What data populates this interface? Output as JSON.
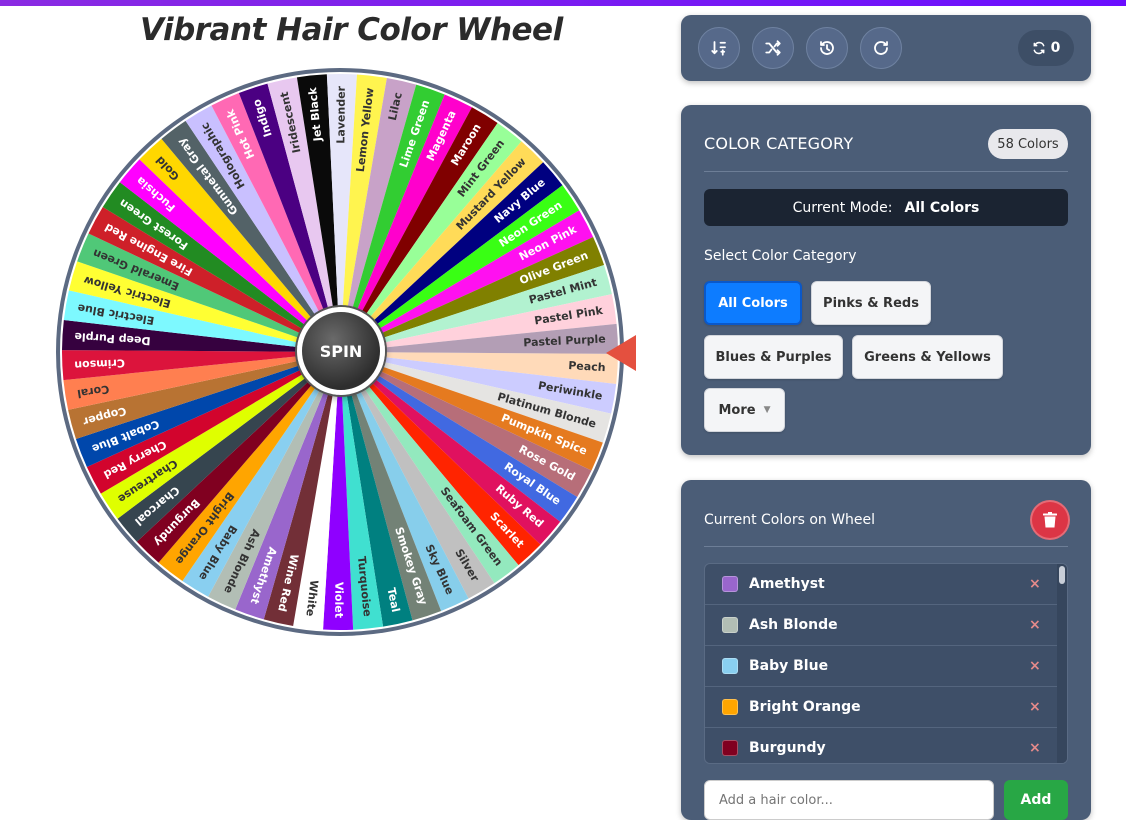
{
  "app": {
    "title": "Vibrant Hair Color Wheel"
  },
  "wheel": {
    "spin_label": "SPIN",
    "segments": [
      {
        "label": "Peach",
        "color": "#FFDAB9",
        "text": "#333333"
      },
      {
        "label": "Periwinkle",
        "color": "#CCCCFF",
        "text": "#333333"
      },
      {
        "label": "Platinum Blonde",
        "color": "#E5E4E2",
        "text": "#333333"
      },
      {
        "label": "Pumpkin Spice",
        "color": "#E57A1F",
        "text": "#ffffff"
      },
      {
        "label": "Rose Gold",
        "color": "#B76E79",
        "text": "#ffffff"
      },
      {
        "label": "Royal Blue",
        "color": "#4169E1",
        "text": "#ffffff"
      },
      {
        "label": "Ruby Red",
        "color": "#E0115F",
        "text": "#ffffff"
      },
      {
        "label": "Scarlet",
        "color": "#FF2400",
        "text": "#ffffff"
      },
      {
        "label": "Seafoam Green",
        "color": "#93E9BE",
        "text": "#333333"
      },
      {
        "label": "Silver",
        "color": "#C0C0C0",
        "text": "#333333"
      },
      {
        "label": "Sky Blue",
        "color": "#87CEEB",
        "text": "#333333"
      },
      {
        "label": "Smokey Gray",
        "color": "#738276",
        "text": "#ffffff"
      },
      {
        "label": "Teal",
        "color": "#008080",
        "text": "#ffffff"
      },
      {
        "label": "Turquoise",
        "color": "#40E0D0",
        "text": "#333333"
      },
      {
        "label": "Violet",
        "color": "#8F00FF",
        "text": "#ffffff"
      },
      {
        "label": "White",
        "color": "#FFFFFF",
        "text": "#333333"
      },
      {
        "label": "Wine Red",
        "color": "#722F37",
        "text": "#ffffff"
      },
      {
        "label": "Amethyst",
        "color": "#9966CC",
        "text": "#ffffff"
      },
      {
        "label": "Ash Blonde",
        "color": "#B2BEB5",
        "text": "#333333"
      },
      {
        "label": "Baby Blue",
        "color": "#89CFF0",
        "text": "#333333"
      },
      {
        "label": "Bright Orange",
        "color": "#FFA500",
        "text": "#333333"
      },
      {
        "label": "Burgundy",
        "color": "#800020",
        "text": "#ffffff"
      },
      {
        "label": "Charcoal",
        "color": "#36454F",
        "text": "#ffffff"
      },
      {
        "label": "Chartreuse",
        "color": "#DFFF00",
        "text": "#333333"
      },
      {
        "label": "Cherry Red",
        "color": "#D2042D",
        "text": "#ffffff"
      },
      {
        "label": "Cobalt Blue",
        "color": "#0047AB",
        "text": "#ffffff"
      },
      {
        "label": "Copper",
        "color": "#B87333",
        "text": "#ffffff"
      },
      {
        "label": "Coral",
        "color": "#FF7F50",
        "text": "#333333"
      },
      {
        "label": "Crimson",
        "color": "#DC143C",
        "text": "#ffffff"
      },
      {
        "label": "Deep Purple",
        "color": "#36013F",
        "text": "#ffffff"
      },
      {
        "label": "Electric Blue",
        "color": "#7DF9FF",
        "text": "#333333"
      },
      {
        "label": "Electric Yellow",
        "color": "#FFFF33",
        "text": "#333333"
      },
      {
        "label": "Emerald Green",
        "color": "#50C878",
        "text": "#333333"
      },
      {
        "label": "Fire Engine Red",
        "color": "#CE2029",
        "text": "#ffffff"
      },
      {
        "label": "Forest Green",
        "color": "#228B22",
        "text": "#ffffff"
      },
      {
        "label": "Fuchsia",
        "color": "#FF00FF",
        "text": "#ffffff"
      },
      {
        "label": "Gold",
        "color": "#FFD700",
        "text": "#333333"
      },
      {
        "label": "Gunmetal Gray",
        "color": "#536267",
        "text": "#ffffff"
      },
      {
        "label": "Holographic",
        "color": "#C9C0FF",
        "text": "#333333"
      },
      {
        "label": "Hot Pink",
        "color": "#FF69B4",
        "text": "#ffffff"
      },
      {
        "label": "Indigo",
        "color": "#4B0082",
        "text": "#ffffff"
      },
      {
        "label": "Iridescent",
        "color": "#E8C8F0",
        "text": "#333333"
      },
      {
        "label": "Jet Black",
        "color": "#0A0A0A",
        "text": "#ffffff"
      },
      {
        "label": "Lavender",
        "color": "#E6E6FA",
        "text": "#333333"
      },
      {
        "label": "Lemon Yellow",
        "color": "#FFF44F",
        "text": "#333333"
      },
      {
        "label": "Lilac",
        "color": "#C8A2C8",
        "text": "#333333"
      },
      {
        "label": "Lime Green",
        "color": "#32CD32",
        "text": "#ffffff"
      },
      {
        "label": "Magenta",
        "color": "#FF00CC",
        "text": "#ffffff"
      },
      {
        "label": "Maroon",
        "color": "#800000",
        "text": "#ffffff"
      },
      {
        "label": "Mint Green",
        "color": "#98FF98",
        "text": "#333333"
      },
      {
        "label": "Mustard Yellow",
        "color": "#FFDB58",
        "text": "#333333"
      },
      {
        "label": "Navy Blue",
        "color": "#000080",
        "text": "#ffffff"
      },
      {
        "label": "Neon Green",
        "color": "#39FF14",
        "text": "#ffffff"
      },
      {
        "label": "Neon Pink",
        "color": "#FF10F0",
        "text": "#ffffff"
      },
      {
        "label": "Olive Green",
        "color": "#808000",
        "text": "#ffffff"
      },
      {
        "label": "Pastel Mint",
        "color": "#B2F2D0",
        "text": "#333333"
      },
      {
        "label": "Pastel Pink",
        "color": "#FFD1DC",
        "text": "#333333"
      },
      {
        "label": "Pastel Purple",
        "color": "#B39EB5",
        "text": "#333333"
      }
    ]
  },
  "toolbar": {
    "counter_value": "0"
  },
  "category": {
    "heading": "COLOR CATEGORY",
    "count_badge": "58 Colors",
    "mode_label": "Current Mode:",
    "mode_value": "All Colors",
    "select_label": "Select Color Category",
    "buttons": [
      "All Colors",
      "Pinks & Reds",
      "Blues & Purples",
      "Greens & Yellows",
      "More"
    ]
  },
  "current_list": {
    "heading": "Current Colors on Wheel",
    "items": [
      {
        "label": "Amethyst",
        "color": "#9966CC"
      },
      {
        "label": "Ash Blonde",
        "color": "#B2BEB5"
      },
      {
        "label": "Baby Blue",
        "color": "#89CFF0"
      },
      {
        "label": "Bright Orange",
        "color": "#FFA500"
      },
      {
        "label": "Burgundy",
        "color": "#800020"
      }
    ],
    "remove_glyph": "×"
  },
  "add": {
    "placeholder": "Add a hair color...",
    "button_label": "Add"
  },
  "colors": {
    "panel_bg": "#4b5d77",
    "accent_blue": "#0d7cff",
    "danger_red": "#dc3545",
    "success_green": "#28a745",
    "pointer_red": "#e4503f"
  }
}
